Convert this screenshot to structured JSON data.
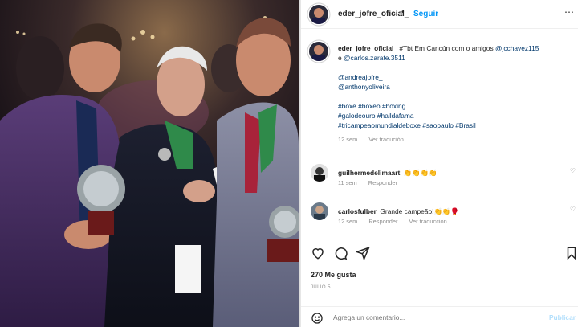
{
  "post": {
    "username": "eder_jofre_oficial_",
    "follow_label": "Seguir",
    "caption_username": "eder_jofre_oficial_",
    "caption_text": " #Tbt Em Cancún com o amigos ",
    "mention1": "@jcchavez115",
    "caption_and": "e ",
    "mention2": "@carlos.zarate.3511",
    "mention3": "@andreajofre_",
    "mention4": "@anthonyoliveira",
    "hashtags_line1": "#boxe #boxeo #boxing",
    "hashtags_line2": "#galodeouro #halldafama",
    "hashtags_line3": "#tricampeaomundialdeboxe #saopaulo #Brasil",
    "caption_time": "12 sem",
    "see_translation": "Ver tradución"
  },
  "comments": [
    {
      "user": "guilhermedelimaart",
      "text": "👏👏👏👏",
      "time": "11 sem",
      "reply": "Responder",
      "translate": ""
    },
    {
      "user": "carlosfulber",
      "text": "Grande campeão!👏👏🥊",
      "time": "12 sem",
      "reply": "Responder",
      "translate": "Ver traducción"
    }
  ],
  "likes_label": "270 Me gusta",
  "date_label": "JULIO 5",
  "add_comment": {
    "placeholder": "Agrega un comentario...",
    "publish": "Publicar"
  },
  "icons": {
    "heart": "heart-icon",
    "comment": "comment-icon",
    "share": "share-icon",
    "save": "bookmark-icon",
    "emoji": "emoji-icon"
  },
  "colors": {
    "link": "#00376b",
    "follow": "#0095f6",
    "muted": "#8e8e8e"
  }
}
